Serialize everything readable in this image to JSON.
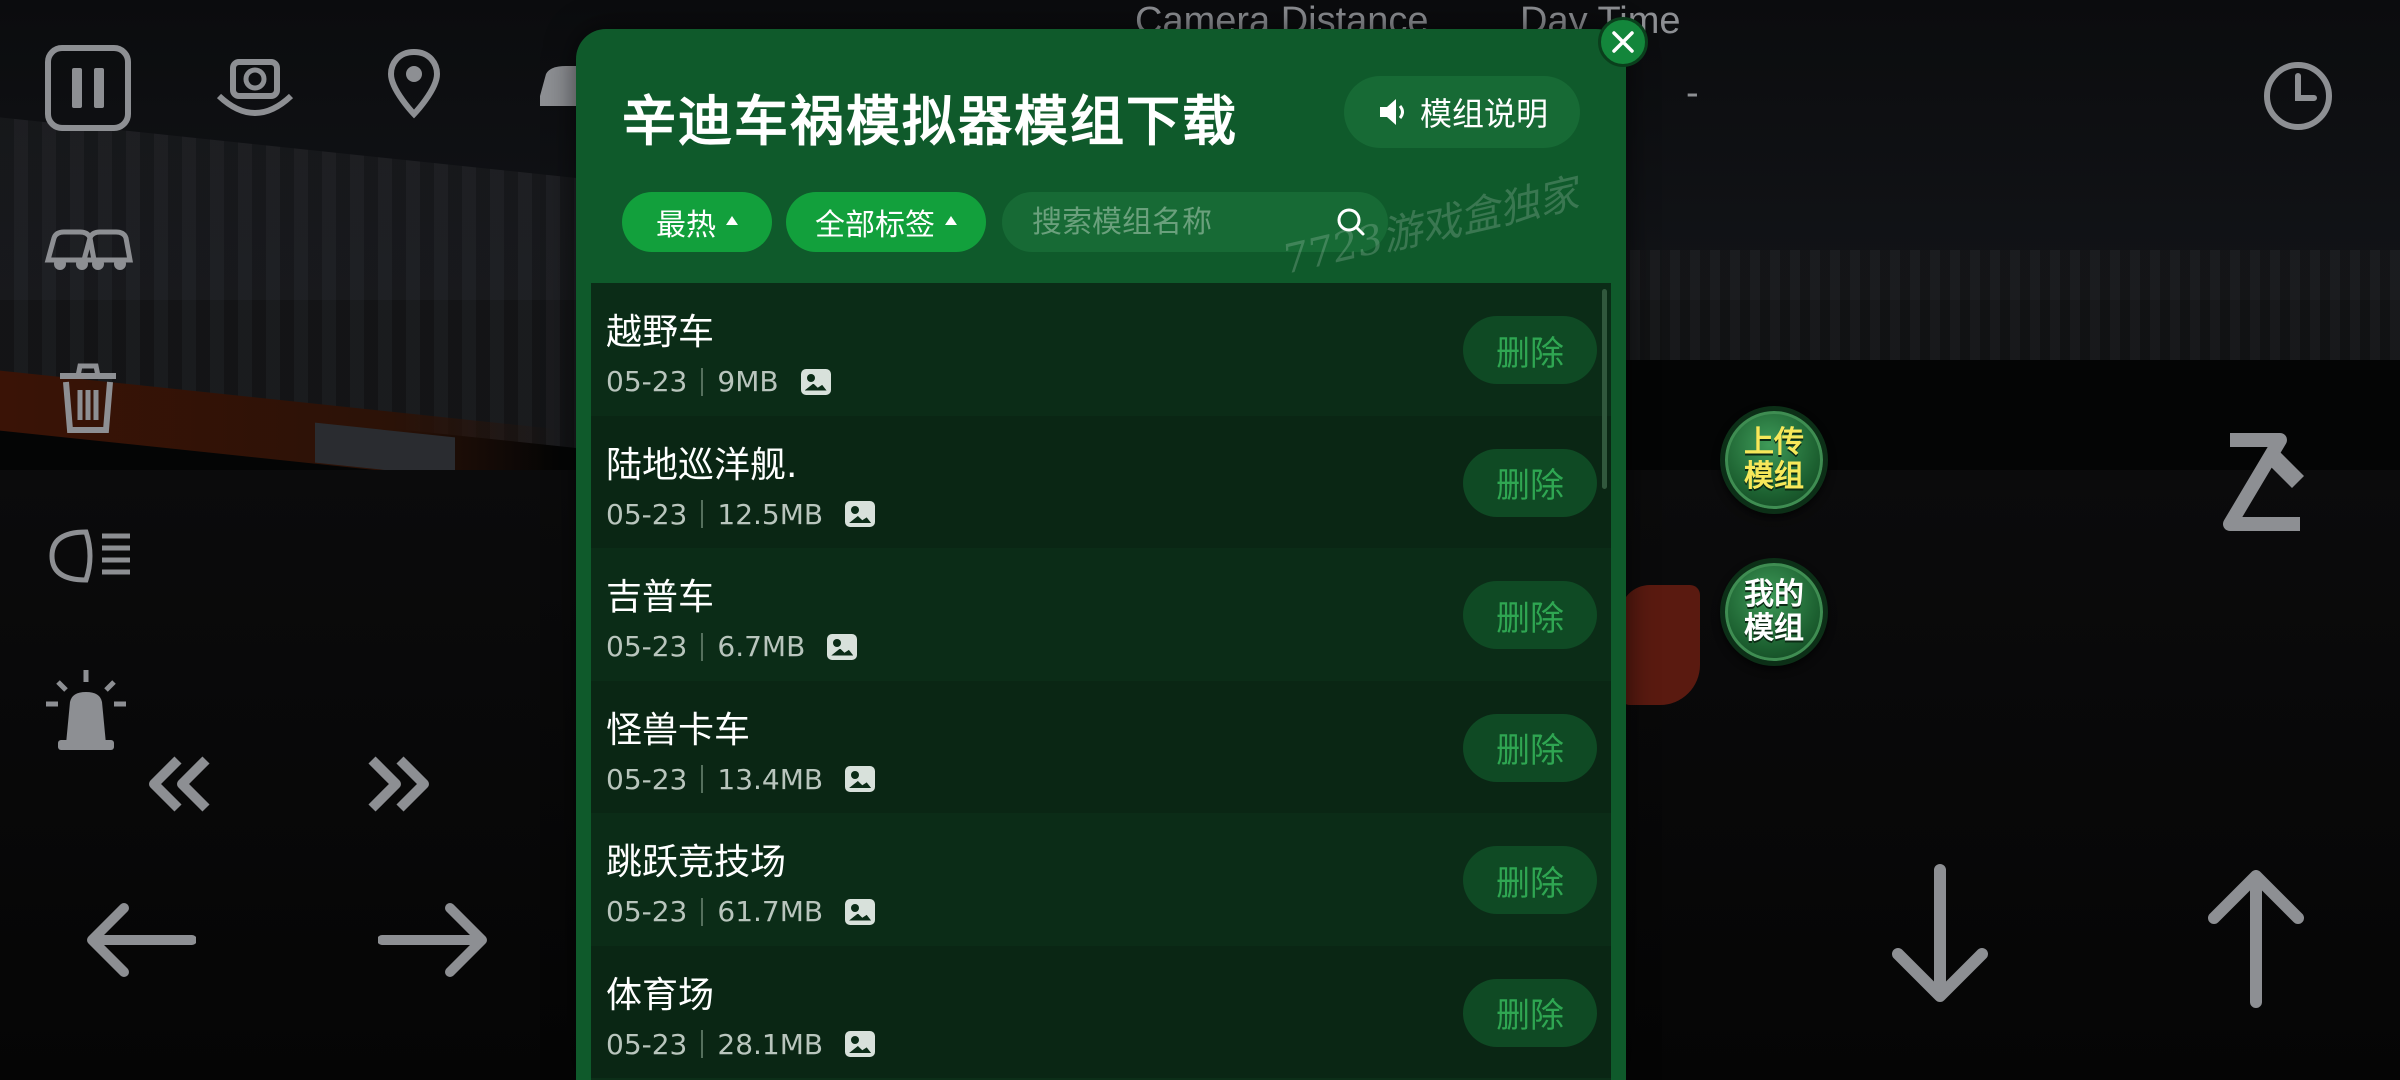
{
  "hud": {
    "camera_distance_label": "Camera Distance",
    "day_time_label": "Day Time",
    "day_time_value": "-"
  },
  "side_buttons": {
    "upload_line1": "上传",
    "upload_line2": "模组",
    "mine_line1": "我的",
    "mine_line2": "模组"
  },
  "modal": {
    "title": "辛迪车祸模拟器模组下载",
    "help_label": "模组说明",
    "filters": {
      "sort_label": "最热",
      "tag_label": "全部标签"
    },
    "search": {
      "placeholder": "搜索模组名称"
    },
    "watermark": "7723游戏盒独家",
    "delete_label": "删除",
    "items": [
      {
        "name": "越野车",
        "date": "05-23",
        "size": "9MB"
      },
      {
        "name": "陆地巡洋舰.",
        "date": "05-23",
        "size": "12.5MB"
      },
      {
        "name": "吉普车",
        "date": "05-23",
        "size": "6.7MB"
      },
      {
        "name": "怪兽卡车",
        "date": "05-23",
        "size": "13.4MB"
      },
      {
        "name": "跳跃竞技场",
        "date": "05-23",
        "size": "61.7MB"
      },
      {
        "name": "体育场",
        "date": "05-23",
        "size": "28.1MB"
      }
    ]
  },
  "colors": {
    "modal_bg": "#0f5a2b",
    "accent_green": "#12a03c",
    "delete_text": "#2fa652",
    "hud_icon": "#8d8f93"
  }
}
